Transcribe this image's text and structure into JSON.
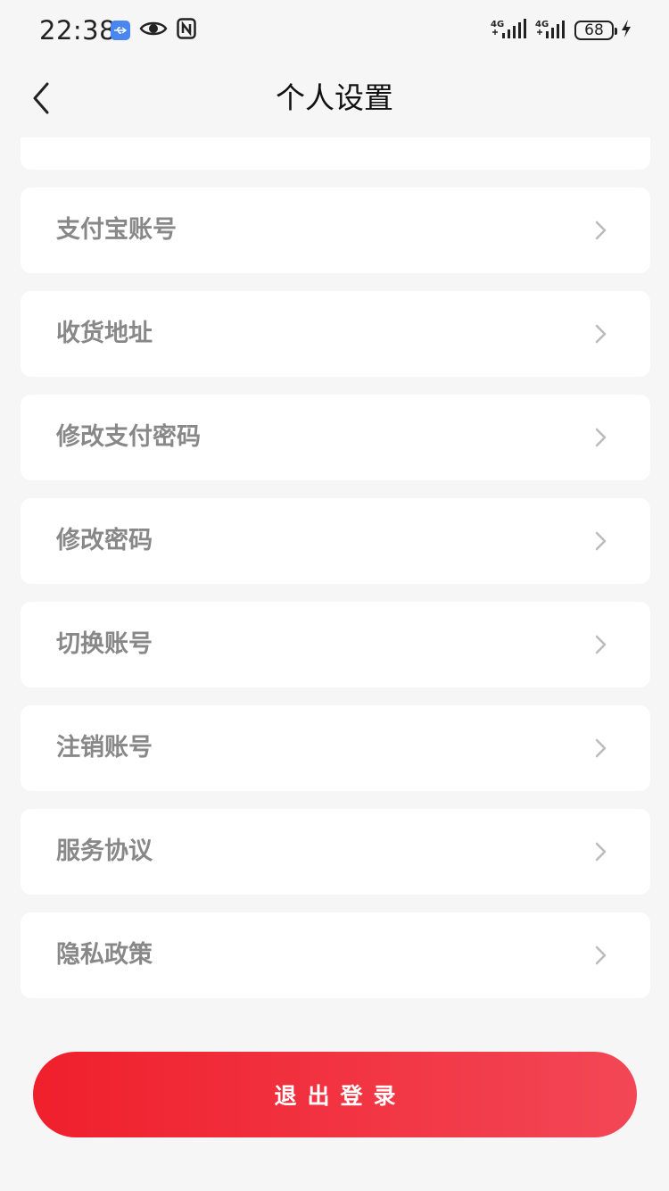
{
  "status_bar": {
    "time": "22:38",
    "network_1": "4G",
    "network_2": "4G",
    "battery": "68",
    "icons": [
      "usb-icon",
      "eye-icon",
      "nfc-icon",
      "signal-icon",
      "signal-icon",
      "battery-icon",
      "charging-icon"
    ]
  },
  "nav": {
    "title": "个人设置",
    "back_icon": "chevron-left-icon"
  },
  "menu": {
    "items": [
      {
        "label": "支付宝账号"
      },
      {
        "label": "收货地址"
      },
      {
        "label": "修改支付密码"
      },
      {
        "label": "修改密码"
      },
      {
        "label": "切换账号"
      },
      {
        "label": "注销账号"
      },
      {
        "label": "服务协议"
      },
      {
        "label": "隐私政策"
      }
    ],
    "item_icon": "chevron-right-icon"
  },
  "logout": {
    "label": "退出登录"
  },
  "colors": {
    "background": "#f6f6f6",
    "card": "#ffffff",
    "label": "#888888",
    "accent_start": "#f01f2c",
    "accent_end": "#f34756"
  }
}
